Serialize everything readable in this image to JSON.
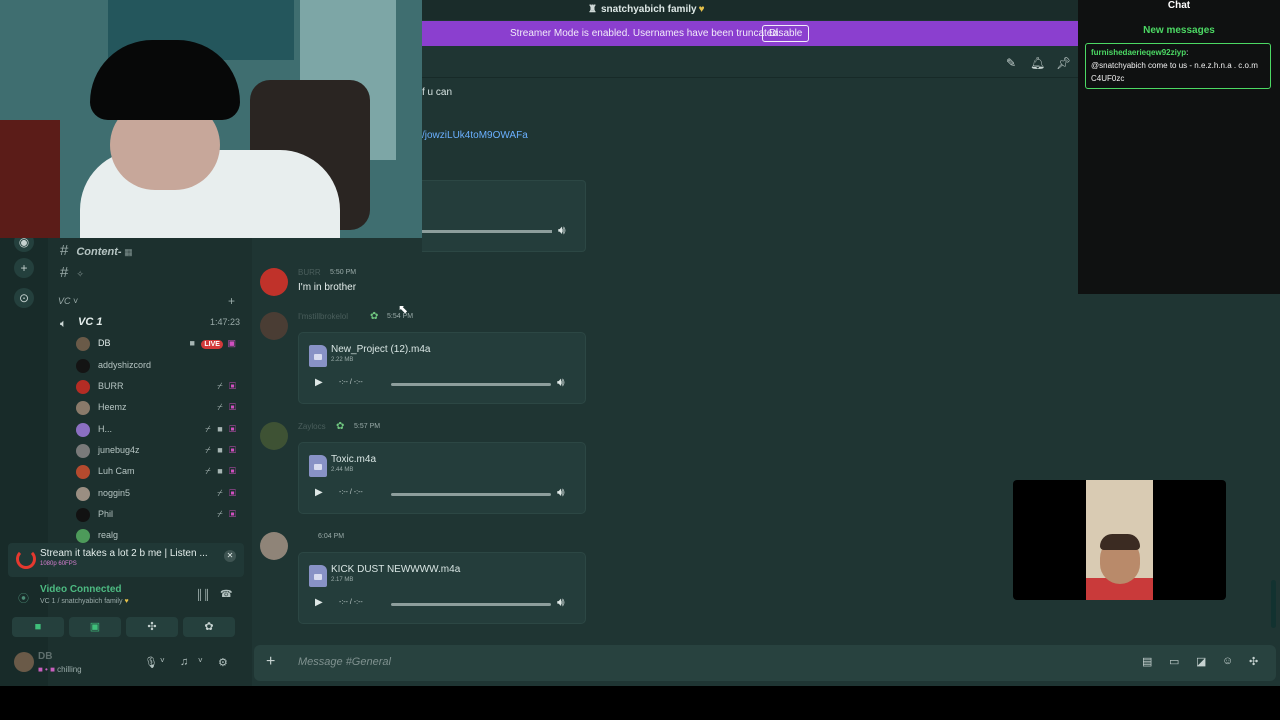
{
  "server": {
    "name": "snatchyabich family"
  },
  "streamer_banner": {
    "text": "Streamer Mode is enabled. Usernames have been truncated.",
    "disable_label": "Disable"
  },
  "channels": [
    {
      "label": "Content-"
    },
    {
      "label": ""
    }
  ],
  "voice": {
    "category": "VC",
    "channel": {
      "name": "VC 1",
      "duration": "1:47:23"
    },
    "users": [
      {
        "name": "DB",
        "live": "LIVE"
      },
      {
        "name": "addyshizcord"
      },
      {
        "name": "BURR"
      },
      {
        "name": "Heemz"
      },
      {
        "name": "H..."
      },
      {
        "name": "junebug4z"
      },
      {
        "name": "Luh Cam"
      },
      {
        "name": "noggin5"
      },
      {
        "name": "Phil"
      },
      {
        "name": "realg"
      }
    ]
  },
  "activity": {
    "title": "Stream it takes a lot 2 b me | Listen ...",
    "subtitle": "1080p 60FPS"
  },
  "voice_status": {
    "status": "Video Connected",
    "channel": "VC 1 / snatchyabich family"
  },
  "user_panel": {
    "name": "DB",
    "status": "chilling"
  },
  "messages": {
    "fragment_text": "f u can",
    "fragment_link": "/jowziLUk4toM9OWAFa",
    "items": [
      {
        "author": "BURR",
        "time": "5:50 PM",
        "text": "I'm in brother"
      },
      {
        "author": "I'mstillbrokelol",
        "time": "5:54 PM",
        "file": {
          "name": "New_Project (12).m4a",
          "size": "2.22 MB",
          "time": "-:-- / -:--"
        }
      },
      {
        "author": "Zaylocs",
        "time": "5:57 PM",
        "file": {
          "name": "Toxic.m4a",
          "size": "2.44 MB",
          "time": "-:-- / -:--"
        }
      },
      {
        "author": "",
        "time": "6:04 PM",
        "file": {
          "name": "KICK DUST NEWWWW.m4a",
          "size": "2.17 MB",
          "time": "-:-- / -:--"
        }
      }
    ]
  },
  "composer": {
    "placeholder": "Message #General"
  },
  "chat": {
    "title": "Chat",
    "new_messages": "New messages",
    "message": {
      "author": "furnishedaerieqew92ziyp",
      "text": "@snatchyabich come to us - n.e.z.h.n.a . c.o.m C4UF0zc"
    }
  },
  "icons": [
    "hashtag-icon",
    "speaker-icon",
    "camera-icon",
    "mic-muted-icon",
    "play-icon",
    "volume-icon",
    "file-icon",
    "gear-icon",
    "headphones-icon",
    "plus-icon"
  ]
}
